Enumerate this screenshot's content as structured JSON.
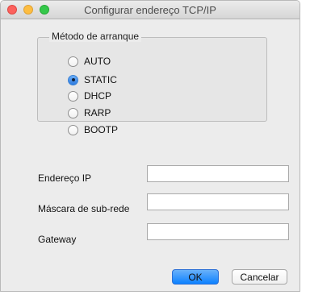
{
  "window": {
    "title": "Configurar endereço TCP/IP"
  },
  "boot_method": {
    "legend": "Método de arranque",
    "options": [
      {
        "label": "AUTO",
        "checked": false
      },
      {
        "label": "STATIC",
        "checked": true
      },
      {
        "label": "DHCP",
        "checked": false
      },
      {
        "label": "RARP",
        "checked": false
      },
      {
        "label": "BOOTP",
        "checked": false
      }
    ]
  },
  "fields": {
    "ip": {
      "label": "Endereço IP",
      "value": ""
    },
    "subnet": {
      "label": "Máscara de sub-rede",
      "value": ""
    },
    "gateway": {
      "label": "Gateway",
      "value": ""
    }
  },
  "buttons": {
    "ok": "OK",
    "cancel": "Cancelar"
  },
  "colors": {
    "accent": "#0d81ff",
    "close": "#fc615d",
    "minimize": "#fdbd41",
    "maximize": "#34c84a"
  }
}
